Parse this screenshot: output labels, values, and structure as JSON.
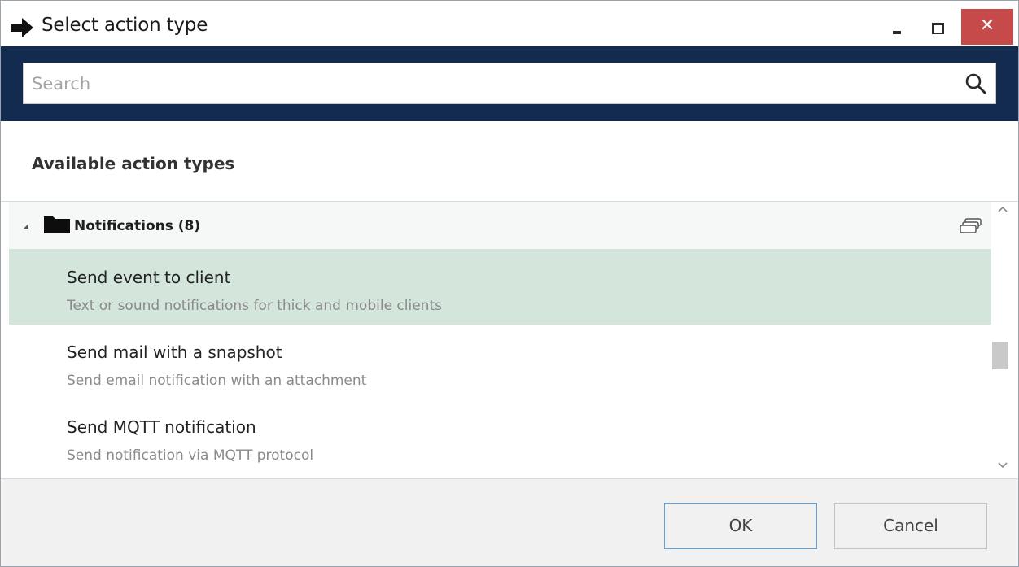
{
  "window": {
    "title": "Select action type",
    "title_icon": "arrow-right-icon",
    "controls": {
      "minimize_icon": "minimize-icon",
      "maximize_icon": "maximize-icon",
      "close_label": "✕"
    }
  },
  "search": {
    "placeholder": "Search",
    "value": "",
    "icon": "search-icon"
  },
  "section": {
    "heading": "Available action types"
  },
  "list": {
    "group": {
      "label": "Notifications (8)",
      "expanded": true
    },
    "items": [
      {
        "title": "Send event to client",
        "description": "Text or sound notifications for thick and mobile clients",
        "selected": true
      },
      {
        "title": "Send mail with a snapshot",
        "description": "Send email notification with an attachment",
        "selected": false
      },
      {
        "title": "Send MQTT notification",
        "description": "Send notification via MQTT protocol",
        "selected": false
      }
    ]
  },
  "footer": {
    "ok_label": "OK",
    "cancel_label": "Cancel"
  },
  "colors": {
    "search_band": "#132b4f",
    "selected_row": "#d4e6dc",
    "close_button": "#c74a4a",
    "ok_border": "#5ba3dc"
  }
}
